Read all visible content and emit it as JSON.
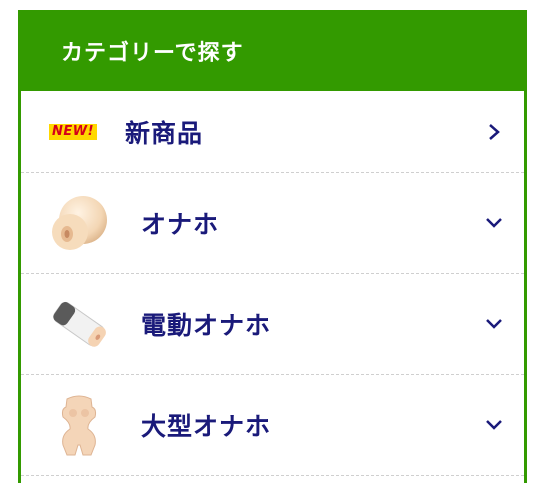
{
  "header": {
    "title": "カテゴリーで探す"
  },
  "colors": {
    "accent": "#339a00",
    "label": "#1a1a7a"
  },
  "categories": [
    {
      "label": "新商品",
      "badge": "NEW!",
      "icon": "new-badge",
      "chevron": "chevron-right-icon"
    },
    {
      "label": "オナホ",
      "icon": "onahole-icon",
      "chevron": "chevron-down-icon"
    },
    {
      "label": "電動オナホ",
      "icon": "electric-onahole-icon",
      "chevron": "chevron-down-icon"
    },
    {
      "label": "大型オナホ",
      "icon": "torso-onahole-icon",
      "chevron": "chevron-down-icon"
    }
  ]
}
